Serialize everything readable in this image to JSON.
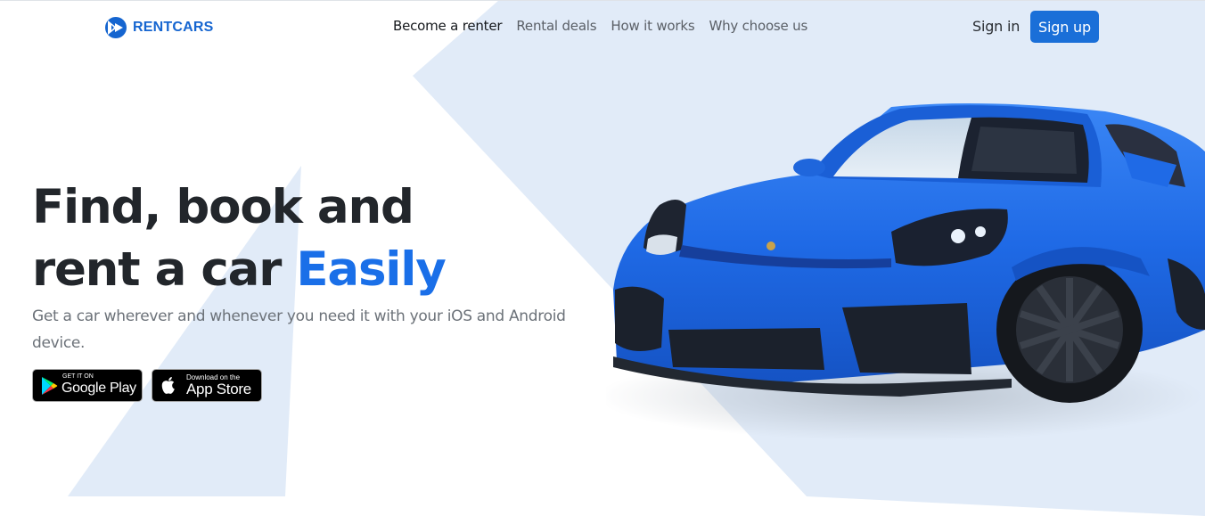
{
  "brand": {
    "name": "RENTCARS",
    "logo_icon": "rentcars-logo-icon",
    "color": "#1565d0"
  },
  "nav": {
    "links": [
      {
        "label": "Become a renter",
        "active": true
      },
      {
        "label": "Rental deals",
        "active": false
      },
      {
        "label": "How it works",
        "active": false
      },
      {
        "label": "Why choose us",
        "active": false
      }
    ],
    "sign_in": "Sign in",
    "sign_up": "Sign up"
  },
  "hero": {
    "title_line1": "Find, book and",
    "title_line2_prefix": "rent a car ",
    "title_accent": "Easily",
    "subtitle": "Get a car wherever and whenever you need it with your iOS and Android device.",
    "accent_color": "#1a6fe8"
  },
  "stores": {
    "google": {
      "small": "GET IT ON",
      "big": "Google Play",
      "icon": "google-play-icon"
    },
    "apple": {
      "small": "Download on the",
      "big": "App Store",
      "icon": "apple-icon"
    }
  },
  "car_image": {
    "description_icon": "blue-sports-car-image",
    "color": "#1f6fe6"
  }
}
